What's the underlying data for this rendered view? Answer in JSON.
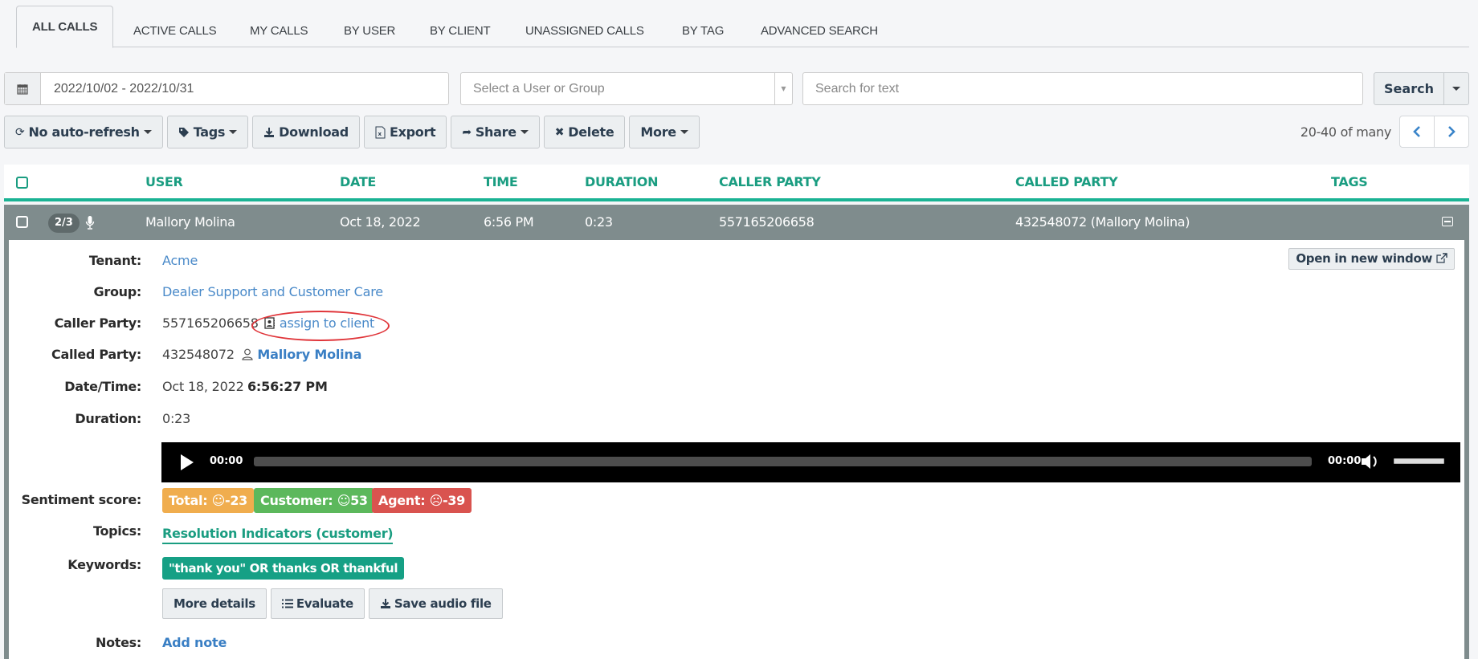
{
  "tabs": [
    {
      "label": "ALL CALLS",
      "active": true
    },
    {
      "label": "ACTIVE CALLS"
    },
    {
      "label": "MY CALLS"
    },
    {
      "label": "BY USER"
    },
    {
      "label": "BY CLIENT"
    },
    {
      "label": "UNASSIGNED CALLS"
    },
    {
      "label": "BY TAG"
    },
    {
      "label": "ADVANCED SEARCH"
    }
  ],
  "filters": {
    "date_range": "2022/10/02 - 2022/10/31",
    "user_select_placeholder": "Select a User or Group",
    "text_search_placeholder": "Search for text",
    "search_label": "Search"
  },
  "toolbar": {
    "refresh_label": "No auto-refresh",
    "tags_label": "Tags",
    "download_label": "Download",
    "export_label": "Export",
    "share_label": "Share",
    "delete_label": "Delete",
    "more_label": "More",
    "pagination_text": "20-40 of many"
  },
  "table": {
    "headers": {
      "user": "USER",
      "date": "DATE",
      "time": "TIME",
      "duration": "DURATION",
      "caller_party": "CALLER PARTY",
      "called_party": "CALLED PARTY",
      "tags": "TAGS"
    },
    "row": {
      "recording_count": "2/3",
      "user": "Mallory Molina",
      "date": "Oct 18, 2022",
      "time": "6:56 PM",
      "duration": "0:23",
      "caller_party": "557165206658",
      "called_party": "432548072 (Mallory Molina)",
      "tags": ""
    }
  },
  "detail": {
    "open_new_window_label": "Open in new window",
    "labels": {
      "tenant": "Tenant:",
      "group": "Group:",
      "caller_party": "Caller Party:",
      "called_party": "Called Party:",
      "date_time": "Date/Time:",
      "duration": "Duration:",
      "sentiment": "Sentiment score:",
      "topics": "Topics:",
      "keywords": "Keywords:",
      "notes": "Notes:"
    },
    "tenant": "Acme",
    "group": "Dealer Support and Customer Care",
    "caller_number": "557165206658",
    "assign_to_client_label": "assign to client",
    "called_number": "432548072",
    "called_user": "Mallory Molina",
    "date": "Oct 18, 2022",
    "time": "6:56:27 PM",
    "duration": "0:23",
    "audio": {
      "current_time": "00:00",
      "total_time": "00:00",
      "progress": 0
    },
    "sentiment": {
      "total": {
        "label": "Total:",
        "value": "-23",
        "color": "#f0ad4e"
      },
      "customer": {
        "label": "Customer:",
        "value": "53",
        "color": "#5cb85c"
      },
      "agent": {
        "label": "Agent:",
        "value": "-39",
        "color": "#d9534f"
      }
    },
    "topic": "Resolution Indicators (customer)",
    "keyword": "\"thank you\" OR thanks OR thankful",
    "actions": {
      "more_details": "More details",
      "evaluate": "Evaluate",
      "save_audio": "Save audio file"
    },
    "add_note_label": "Add note"
  },
  "colors": {
    "accent": "#1ab394",
    "header_text": "#1a9d81",
    "row_bg": "#7f8c8d",
    "link": "#4a8ac9",
    "highlight_ellipse": "#e0353a"
  }
}
